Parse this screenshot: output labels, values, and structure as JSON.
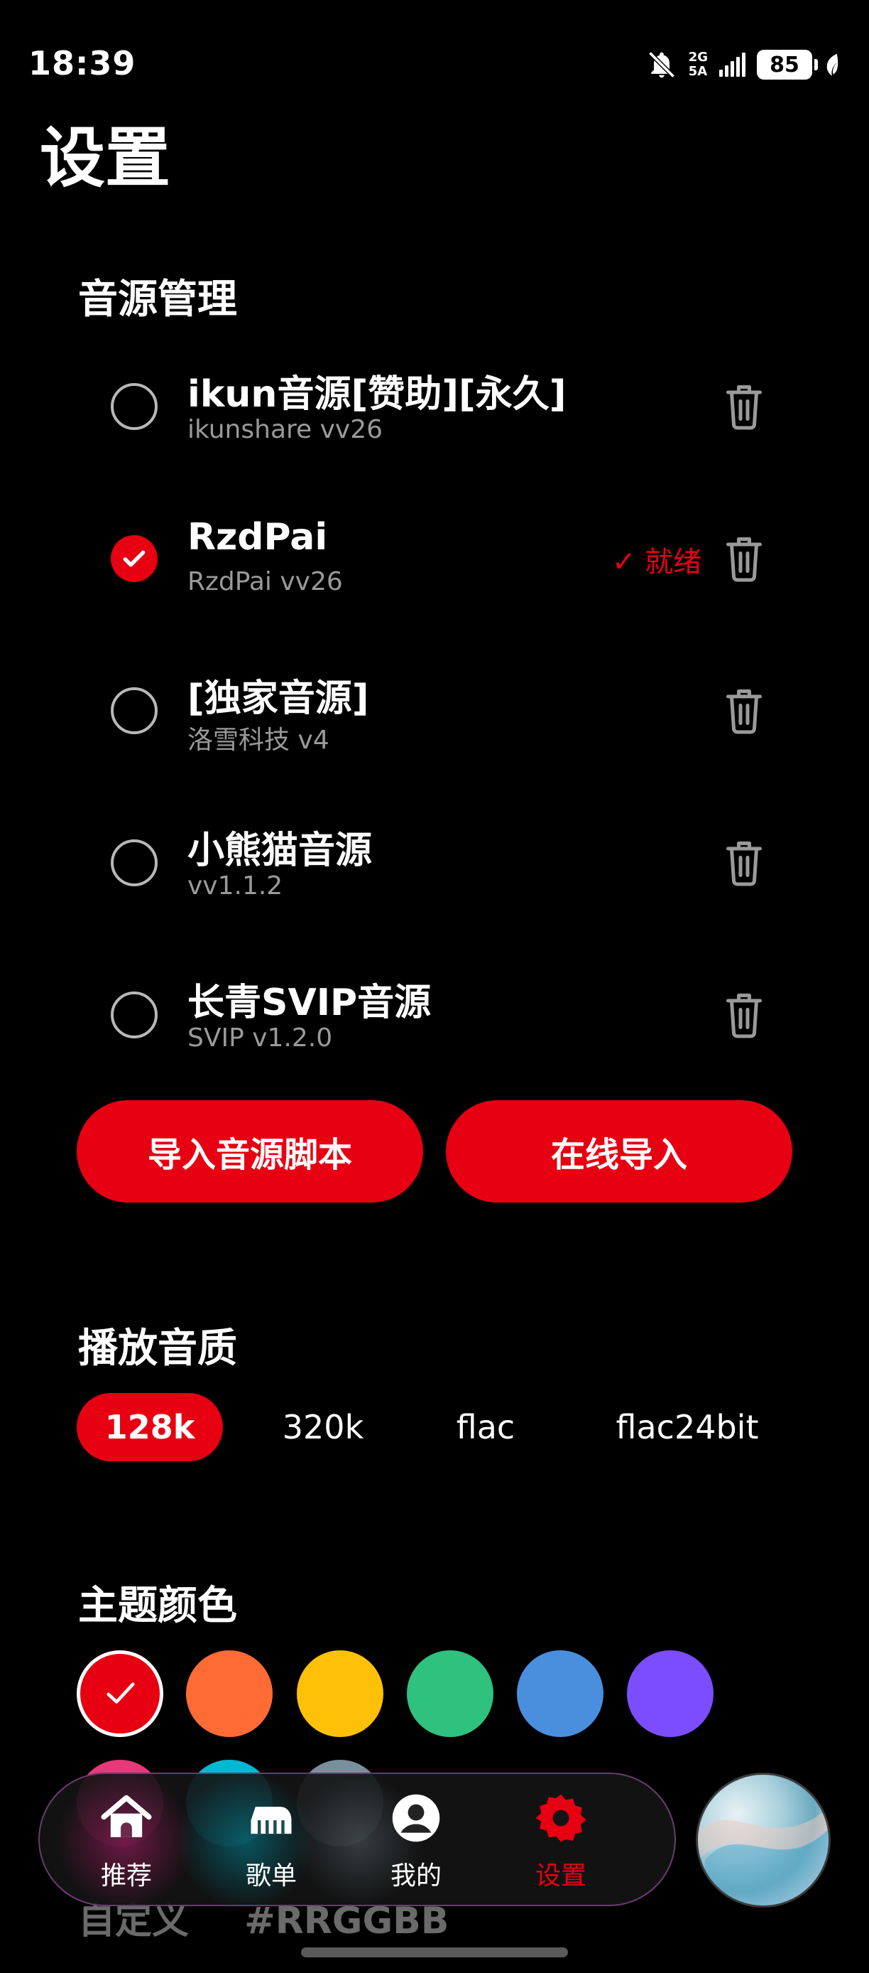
{
  "status_bar": {
    "time": "18:39",
    "network_top": "2G",
    "network_bottom": "5A",
    "battery": "85",
    "icons": [
      "bell-off-icon",
      "signal-icon",
      "battery-icon",
      "leaf-icon"
    ]
  },
  "page_title": "设置",
  "sources": {
    "title": "音源管理",
    "items": [
      {
        "name": "ikun音源[赞助][永久]",
        "sub": "ikunshare vv26",
        "selected": false,
        "status": ""
      },
      {
        "name": "RzdPai",
        "sub": "RzdPai vv26",
        "selected": true,
        "status": "✓ 就绪"
      },
      {
        "name": "[独家音源]",
        "sub": "洛雪科技 v4",
        "selected": false,
        "status": ""
      },
      {
        "name": "小熊猫音源",
        "sub": " vv1.1.2",
        "selected": false,
        "status": ""
      },
      {
        "name": "长青SVIP音源",
        "sub": "SVIP v1.2.0",
        "selected": false,
        "status": ""
      }
    ],
    "import_button": "导入音源脚本",
    "online_button": "在线导入"
  },
  "quality": {
    "title": "播放音质",
    "options": [
      "128k",
      "320k",
      "flac",
      "flac24bit"
    ],
    "selected": "128k"
  },
  "theme": {
    "title": "主题颜色",
    "colors": [
      "#e60012",
      "#ff6b35",
      "#ffc107",
      "#2ec27e",
      "#4a8fdd",
      "#7c4dff"
    ],
    "second_row_colors": [
      "#e5397a",
      "#00b8d4",
      "#78909c"
    ],
    "selected": "#e60012",
    "custom_label": "自定义",
    "custom_placeholder": "#RRGGBB"
  },
  "nav": {
    "items": [
      {
        "label": "推荐",
        "icon": "home-icon",
        "active": false
      },
      {
        "label": "歌单",
        "icon": "piano-icon",
        "active": false
      },
      {
        "label": "我的",
        "icon": "user-icon",
        "active": false
      },
      {
        "label": "设置",
        "icon": "gear-icon",
        "active": true
      }
    ],
    "fab_icon": "album-art"
  },
  "colors": {
    "accent": "#e60012",
    "background": "#000000",
    "muted_text": "#9a9a9a"
  }
}
